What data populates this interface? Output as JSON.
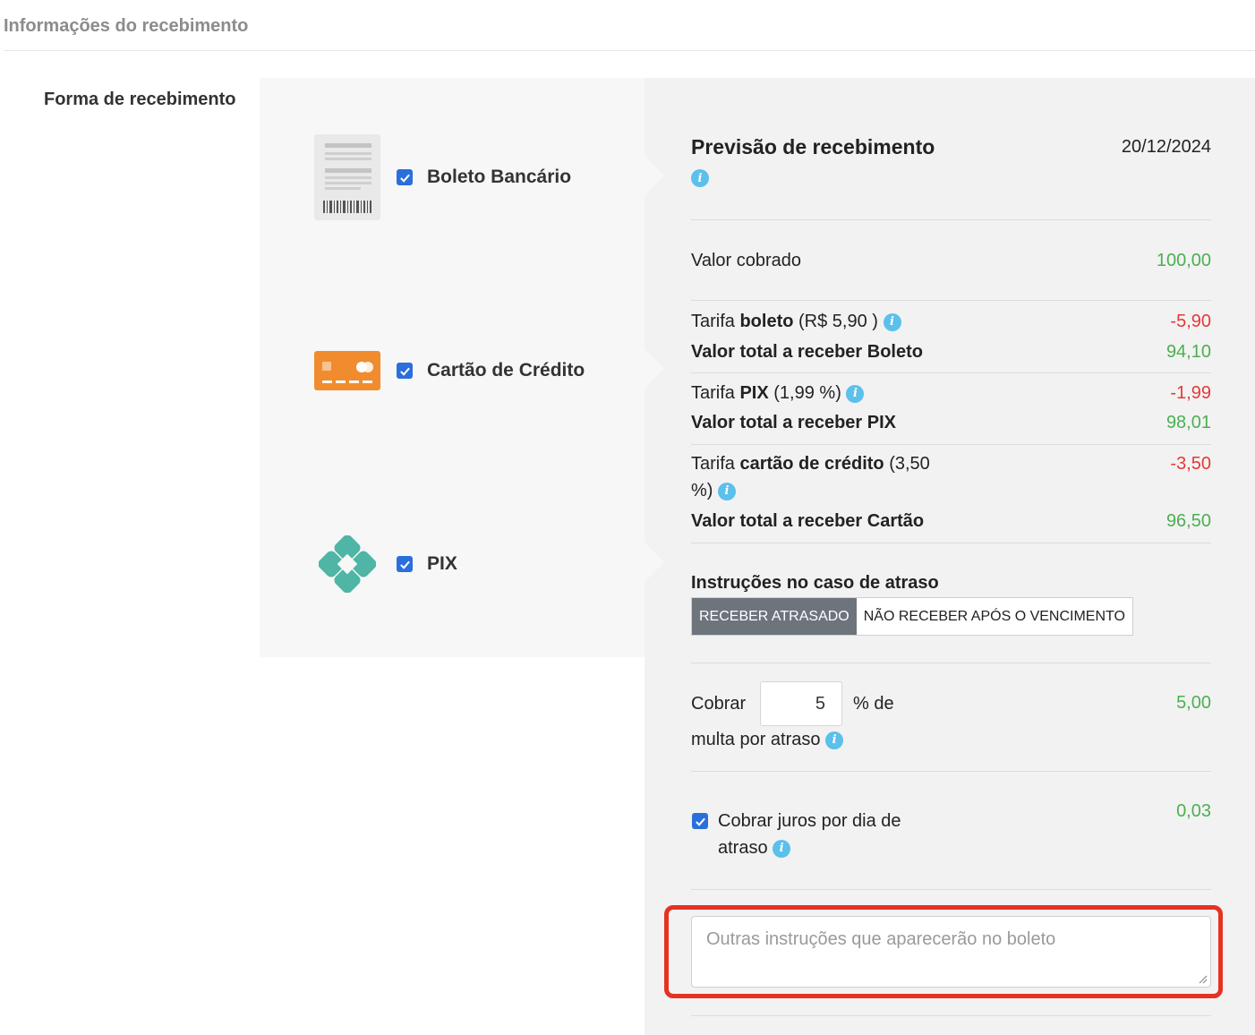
{
  "section": {
    "title": "Informações do recebimento"
  },
  "form_label": "Forma de recebimento",
  "methods": [
    {
      "label": "Boleto Bancário",
      "checked": true,
      "icon": "boleto-icon"
    },
    {
      "label": "Cartão de Crédito",
      "checked": true,
      "icon": "credit-card-icon"
    },
    {
      "label": "PIX",
      "checked": true,
      "icon": "pix-icon"
    }
  ],
  "summary": {
    "title": "Previsão de recebimento",
    "date": "20/12/2024",
    "valor_cobrado_label": "Valor cobrado",
    "valor_cobrado": "100,00",
    "boleto": {
      "tarifa_prefix": "Tarifa ",
      "tarifa_bold": "boleto",
      "tarifa_suffix": " (R$ 5,90 )",
      "tarifa_value": "-5,90",
      "total_label": "Valor total a receber Boleto",
      "total_value": "94,10"
    },
    "pix": {
      "tarifa_prefix": "Tarifa ",
      "tarifa_bold": "PIX",
      "tarifa_suffix": " (1,99 %)",
      "tarifa_value": "-1,99",
      "total_label": "Valor total a receber PIX",
      "total_value": "98,01"
    },
    "cartao": {
      "tarifa_prefix": "Tarifa ",
      "tarifa_bold": "cartão de crédito",
      "tarifa_suffix": " (3,50",
      "tarifa_line2": "%)",
      "tarifa_value": "-3,50",
      "total_label": "Valor total a receber Cartão",
      "total_value": "96,50"
    }
  },
  "atraso": {
    "title": "Instruções no caso de atraso",
    "options": [
      "RECEBER ATRASADO",
      "NÃO RECEBER APÓS O VENCIMENTO"
    ],
    "selected": "RECEBER ATRASADO",
    "multa_prefix": "Cobrar",
    "multa_value": "5",
    "multa_suffix": "% de",
    "multa_line2": "multa por atraso",
    "multa_amount": "5,00",
    "juros_checked": true,
    "juros_line1": "Cobrar juros por dia de",
    "juros_line2": "atraso",
    "juros_amount": "0,03"
  },
  "instructions": {
    "placeholder": "Outras instruções que aparecerão no boleto"
  },
  "colors": {
    "checkbox": "#2a6fdb",
    "positive": "#4caf50",
    "negative": "#e53935",
    "info": "#5bc0eb",
    "highlight": "#e53223",
    "segment_active": "#6d747c"
  }
}
